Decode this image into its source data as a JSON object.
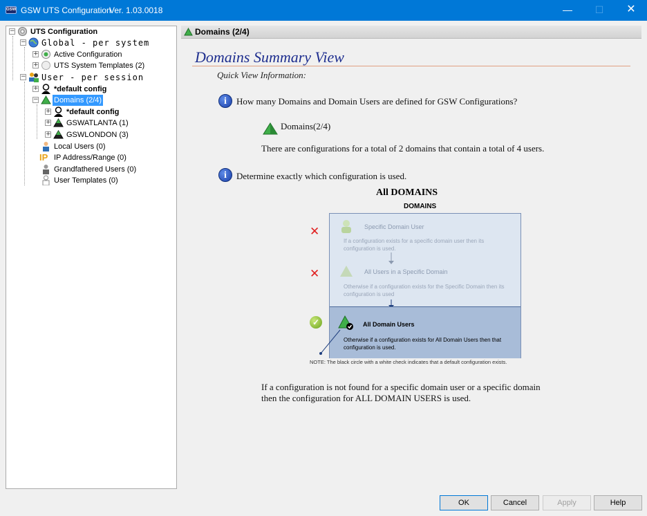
{
  "window": {
    "title": "GSW UTS Configuration",
    "version": "Ver. 1.03.0018",
    "icon_text": "GSW"
  },
  "tree": {
    "root": "UTS Configuration",
    "global": "Global  - per system",
    "active_config": "Active Configuration",
    "uts_templates": "UTS System Templates (2)",
    "user": "User    - per session",
    "default_config": "*default config",
    "domains": "Domains (2/4)",
    "domains_default_config": "*default config",
    "gswatlanta": "GSWATLANTA (1)",
    "gswlondon": "GSWLONDON (3)",
    "local_users": "Local Users (0)",
    "ip_range": "IP Address/Range (0)",
    "grandfathered": "Grandfathered Users (0)",
    "user_templates": "User Templates (0)"
  },
  "panel": {
    "header": "Domains (2/4)",
    "title": "Domains Summary View",
    "quick_view": "Quick View Information:",
    "q1": "How many Domains and Domain Users are defined for GSW Configurations?",
    "domains_label": "Domains(2/4)",
    "configs_text": "There are configurations for a total of 2 domains that contain a total of 4 users.",
    "q2": "Determine exactly which configuration is used.",
    "all_domains": "All DOMAINS",
    "final_text": "If a configuration is not found for a specific domain user or a specific domain then the configuration for ALL DOMAIN USERS is used."
  },
  "diagram": {
    "title": "DOMAINS",
    "step1_label": "Specific Domain User",
    "step1_text": "If a configuration exists for a specific domain user then its configuration is used.",
    "step2_label": "All Users in a Specific Domain",
    "step2_text": "Otherwise if a configuration exists for the Specific Domain then its configuration is used",
    "step3_label": "All Domain Users",
    "step3_text": "Otherwise if a configuration exists for All Domain Users then that configuration is used.",
    "note": "NOTE: The black circle with a white check indicates that a default configuration exists."
  },
  "buttons": {
    "ok": "OK",
    "cancel": "Cancel",
    "apply": "Apply",
    "help": "Help"
  },
  "colors": {
    "titlebar": "#0078d7",
    "selected": "#3399ff",
    "heading": "#1f2f8f",
    "x_mark": "#e02020",
    "check": "#6aa21a"
  }
}
